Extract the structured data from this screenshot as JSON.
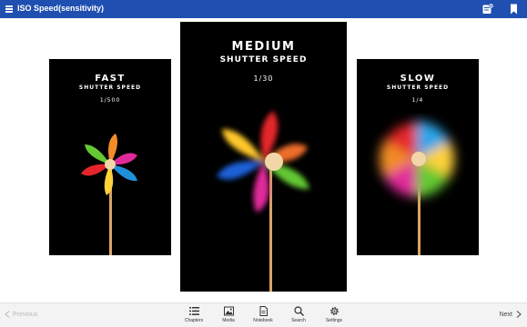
{
  "header": {
    "title": "ISO Speed(sensitivity)",
    "icons": [
      "menu-icon",
      "add-note-icon",
      "bookmark-icon"
    ],
    "color": "#1f4fb0"
  },
  "panels": [
    {
      "name": "FAST",
      "subtitle": "SHUTTER SPEED",
      "value": "1/500"
    },
    {
      "name": "MEDIUM",
      "subtitle": "SHUTTER SPEED",
      "value": "1/30"
    },
    {
      "name": "SLOW",
      "subtitle": "SHUTTER SPEED",
      "value": "1/4"
    }
  ],
  "footer": {
    "previous": "Previous",
    "next": "Next",
    "nav": [
      {
        "label": "Chapters",
        "icon": "list-icon"
      },
      {
        "label": "Media",
        "icon": "image-icon"
      },
      {
        "label": "Notebook",
        "icon": "notebook-icon"
      },
      {
        "label": "Search",
        "icon": "search-icon"
      },
      {
        "label": "Settings",
        "icon": "gear-icon"
      }
    ]
  }
}
